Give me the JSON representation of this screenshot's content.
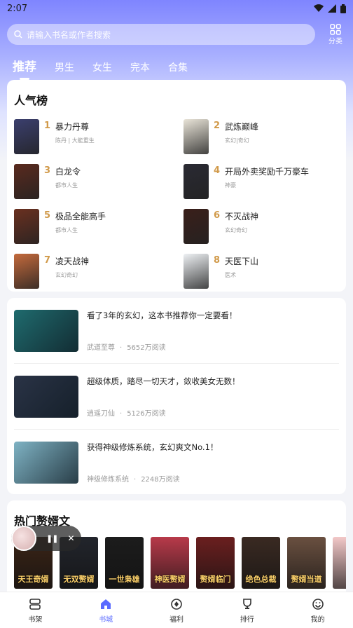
{
  "status": {
    "time": "2:07"
  },
  "search": {
    "placeholder": "请输入书名或作者搜索"
  },
  "category": {
    "label": "分类"
  },
  "tabs": [
    "推荐",
    "男生",
    "女生",
    "完本",
    "合集"
  ],
  "ranking": {
    "title": "人气榜",
    "items": [
      {
        "rank": "1",
        "title": "暴力丹尊",
        "sub": "陈丹 | 大能重生",
        "color": "#3b3f6e"
      },
      {
        "rank": "2",
        "title": "武炼巅峰",
        "sub": "玄幻|奇幻",
        "color": "#e9e4d8"
      },
      {
        "rank": "3",
        "title": "白龙令",
        "sub": "都市人生",
        "color": "#5a2a1e"
      },
      {
        "rank": "4",
        "title": "开局外卖奖励千万豪车",
        "sub": "神豪",
        "color": "#2a2a33"
      },
      {
        "rank": "5",
        "title": "极品全能高手",
        "sub": "都市人生",
        "color": "#6a3020"
      },
      {
        "rank": "6",
        "title": "不灭战神",
        "sub": "玄幻奇幻",
        "color": "#3a1f1a"
      },
      {
        "rank": "7",
        "title": "凌天战神",
        "sub": "玄幻奇幻",
        "color": "#c46a3c"
      },
      {
        "rank": "8",
        "title": "天医下山",
        "sub": "医术",
        "color": "#eef1f4"
      }
    ]
  },
  "feed": [
    {
      "title": "看了3年的玄幻，这本书推荐你一定要看！",
      "book": "武道至尊",
      "reads": "5652万阅读",
      "color": "#1f6b6e"
    },
    {
      "title": "超级体质，踏尽一切天才，敛收美女无数！",
      "book": "逍遥刀仙",
      "reads": "5126万阅读",
      "color": "#2a3346"
    },
    {
      "title": "获得神级修炼系统，玄幻爽文No.1！",
      "book": "神级修炼系统",
      "reads": "2248万阅读",
      "color": "#7fb3c4"
    }
  ],
  "hot": {
    "title": "热门赘婿文",
    "covers": [
      {
        "text": "天王奇婿",
        "color": "#3b2416"
      },
      {
        "text": "无双赘婿",
        "color": "#22252c"
      },
      {
        "text": "一世枭雄",
        "color": "#1c1c1c"
      },
      {
        "text": "神医赘婿",
        "color": "#b83a4a"
      },
      {
        "text": "赘婿临门",
        "color": "#6b1f1f"
      },
      {
        "text": "绝色总裁",
        "color": "#3a2a22"
      },
      {
        "text": "赘婿当道",
        "color": "#6a5040"
      },
      {
        "text": "",
        "color": "#f3c8c8"
      }
    ]
  },
  "separator": "·",
  "nav": [
    {
      "label": "书架",
      "icon": "bookshelf-icon"
    },
    {
      "label": "书城",
      "icon": "store-icon",
      "active": true
    },
    {
      "label": "福利",
      "icon": "gift-coin-icon"
    },
    {
      "label": "排行",
      "icon": "trophy-icon"
    },
    {
      "label": "我的",
      "icon": "profile-icon"
    }
  ],
  "colors": {
    "accent": "#5b6bff",
    "rank": "#d19a4a"
  }
}
